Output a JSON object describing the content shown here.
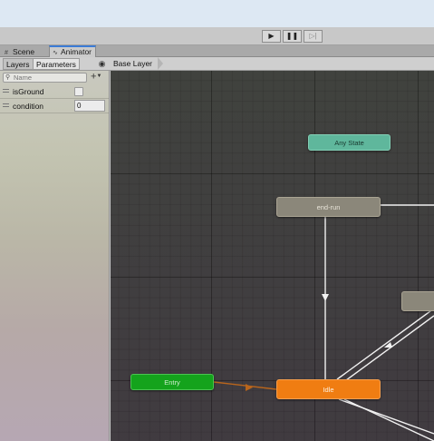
{
  "toolbar": {
    "play_icon": "play-icon",
    "pause_icon": "pause-icon",
    "step_icon": "step-icon"
  },
  "tabs": [
    {
      "label": "Scene",
      "icon": "grid-icon"
    },
    {
      "label": "Animator",
      "icon": "animator-icon"
    }
  ],
  "subtabs": {
    "layers": "Layers",
    "parameters": "Parameters"
  },
  "breadcrumb": "Base Layer",
  "search": {
    "placeholder": "Name"
  },
  "parameters": [
    {
      "name": "isGround",
      "type": "bool",
      "value": false
    },
    {
      "name": "condition",
      "type": "int",
      "value": "0"
    }
  ],
  "states": {
    "any_state": "Any State",
    "end_run": "end-run",
    "entry": "Entry",
    "idle": "Idle",
    "right_state": ""
  },
  "colors": {
    "entry": "#14a31c",
    "default_state": "#f07d12",
    "any_state": "#5fb79c",
    "state": "#8b877a",
    "transition": "#f2f2f2",
    "entry_transition": "#b9651c"
  }
}
